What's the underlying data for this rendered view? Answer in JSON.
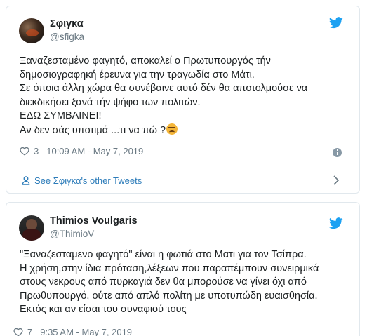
{
  "tweets": [
    {
      "name": "Σφιγκα",
      "handle": "@sfigka",
      "lines": [
        "Ξαναζεσταμένο φαγητό, αποκαλεί ο Πρωτυπουργός τήν",
        "δημοσιογραφηκή έρευνα για την τραγωδία στο Μάτι.",
        "Σε όποια άλλη χώρα θα συνέβαινε αυτό δέν θα αποτολμούσε να",
        "διεκδικήσει ξανά τήν ψήφο των πολιτών.",
        "ΕΔΩ ΣΥΜΒΑΙΝΕΙ!",
        "Αν δεν σάς υποτιμά ...τι να πώ ?"
      ],
      "emoji_icon": "angry-face-icon",
      "likes": "3",
      "timestamp": "10:09 AM - May 7, 2019",
      "see_other": "See Σφιγκα's other Tweets"
    },
    {
      "name": "Thimios Voulgaris",
      "handle": "@ThimioV",
      "lines": [
        "\"Ξαναζεσταμενο φαγητό\" είναι η φωτιά στο Ματι για τον Τσίπρα.",
        "Η χρήση,στην ίδια πρόταση,λέξεων που παραπέμπουν συνειρμικά",
        "στους νεκρους από πυρκαγιά δεν θα μπορούσε να γίνει όχι από",
        "Πρωθυπουργό, ούτε από απλό πολίτη με υποτυπώδη ευαισθησία.",
        "Εκτός και αν είσαι του συναφιού τους"
      ],
      "likes": "7",
      "timestamp": "9:35 AM - May 7, 2019"
    }
  ],
  "colors": {
    "link": "#2b7bb9",
    "twitter_blue": "#1da1f2",
    "muted": "#697882",
    "border": "#e1e8ed"
  }
}
